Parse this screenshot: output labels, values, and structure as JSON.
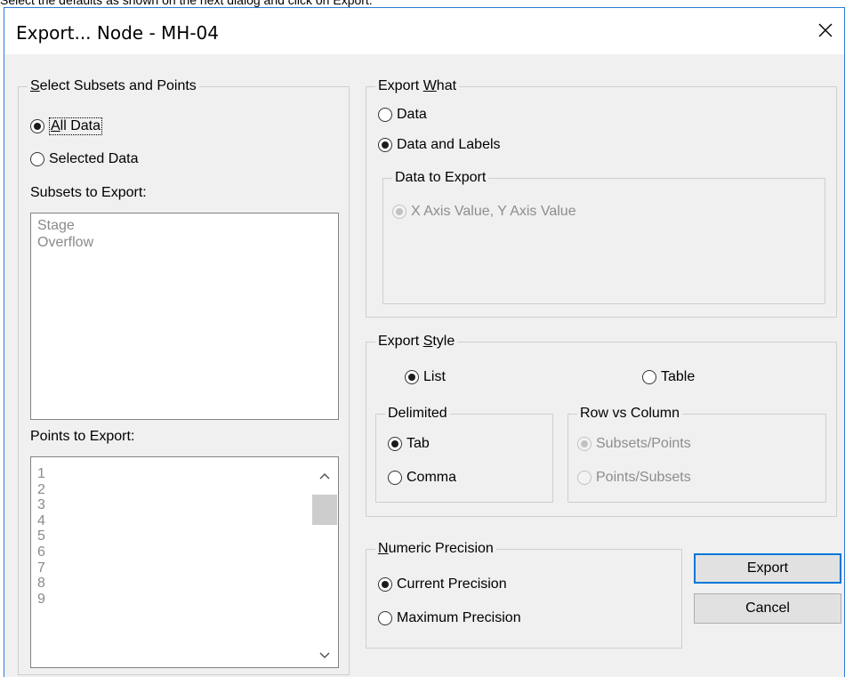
{
  "caption": "Select the defaults as shown on the next dialog and click on Export.",
  "dialog": {
    "title": "Export... Node - MH-04",
    "close_icon": "close-icon"
  },
  "subsets_points": {
    "legend_pre": "",
    "legend_key": "S",
    "legend_post": "elect Subsets and Points",
    "all_data_pre": "",
    "all_data_key": "A",
    "all_data_post": "ll Data",
    "selected_data": "Selected Data",
    "selected_option": "all_data",
    "subsets_label": "Subsets to Export:",
    "subsets": [
      "Stage",
      "Overflow"
    ],
    "points_label": "Points to Export:",
    "points": [
      "1",
      "2",
      "3",
      "4",
      "5",
      "6",
      "7",
      "8",
      "9"
    ],
    "scroll_up_icon": "chevron-up-icon",
    "scroll_down_icon": "chevron-down-icon"
  },
  "export_what": {
    "legend_pre": "Export ",
    "legend_key": "W",
    "legend_post": "hat",
    "data": "Data",
    "data_and_labels": "Data and Labels",
    "selected_option": "data_and_labels",
    "data_to_export": {
      "legend": "Data to Export",
      "option": "X Axis Value, Y Axis Value"
    }
  },
  "export_style": {
    "legend_pre": "Export ",
    "legend_key": "S",
    "legend_post": "tyle",
    "list": "List",
    "table": "Table",
    "selected_option": "list",
    "delimited": {
      "legend": "Delimited",
      "tab": "Tab",
      "comma": "Comma",
      "selected_option": "tab"
    },
    "row_vs_column": {
      "legend": "Row vs Column",
      "subsets_points": "Subsets/Points",
      "points_subsets": "Points/Subsets",
      "selected_option": "subsets_points"
    }
  },
  "numeric_precision": {
    "legend_pre": "",
    "legend_key": "N",
    "legend_post": "umeric Precision",
    "current": "Current Precision",
    "maximum": "Maximum Precision",
    "selected_option": "current"
  },
  "buttons": {
    "export": "Export",
    "cancel": "Cancel"
  },
  "colors": {
    "accent": "#0078d7",
    "dialog_bg": "#f0f0f0",
    "disabled_text": "#8d8d8d"
  }
}
